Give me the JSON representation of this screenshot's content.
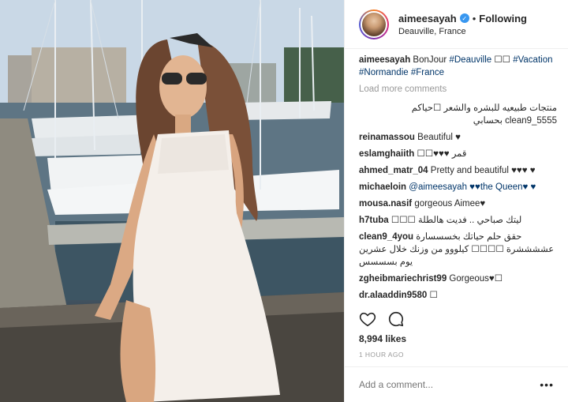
{
  "header": {
    "username": "aimeesayah",
    "follow_status": "Following",
    "separator": "•",
    "location": "Deauville, France"
  },
  "caption": {
    "username": "aimeesayah",
    "text": "BonJour",
    "tags": [
      "#Deauville",
      "#Vacation",
      "#Normandie",
      "#France"
    ],
    "emoji": "☐☐"
  },
  "load_more": "Load more comments",
  "comments": [
    {
      "user": "",
      "text": "منتجات طبيعيه للبشره والشعر ☐حياكم clean9_5555 بحسابي"
    },
    {
      "user": "reinamassou",
      "text": "Beautiful ♥"
    },
    {
      "user": "eslamghaiith",
      "text": "☐☐♥♥♥ قمر"
    },
    {
      "user": "ahmed_matr_04",
      "text": "Pretty and beautiful ♥♥♥ ♥"
    },
    {
      "user": "michaeloin",
      "text": "@aimeesayah ♥♥the Queen♥ ♥"
    },
    {
      "user": "mousa.nasif",
      "text": "gorgeous Aimee♥"
    },
    {
      "user": "h7tuba",
      "text": "☐☐☐ ليتك صباحي .. فديت هالطلة"
    },
    {
      "user": "clean9_4you",
      "text": "حقق حلم حياتك بخسسسارة عششششرة ☐☐☐☐ كيلووو من وزنك خلال عشرين يوم بسسسس"
    },
    {
      "user": "zgheibmariechrist99",
      "text": "Gorgeous♥☐"
    },
    {
      "user": "dr.alaaddin9580",
      "text": "☐"
    }
  ],
  "likes": "8,994 likes",
  "timestamp": "1 HOUR AGO",
  "comment_input": {
    "placeholder": "Add a comment..."
  },
  "more_options": "•••",
  "icons": {
    "like": "heart-icon",
    "comment": "comment-bubble-icon",
    "verified": "verified-badge-icon"
  },
  "colors": {
    "accent": "#3897f0",
    "hashtag": "#003569",
    "muted": "#999999"
  }
}
